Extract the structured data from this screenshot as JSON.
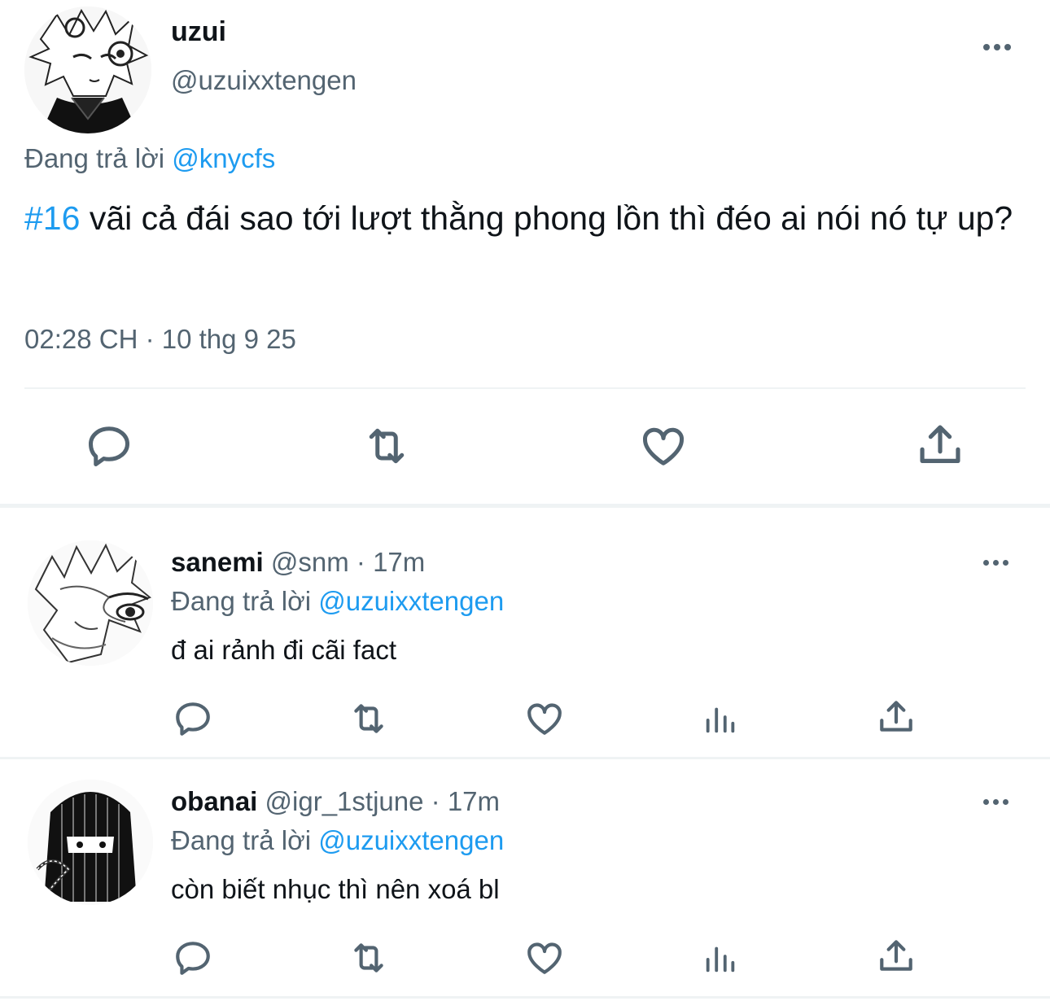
{
  "main_tweet": {
    "display_name": "uzui",
    "handle": "@uzuixxtengen",
    "reply_prefix": "Đang trả lời",
    "reply_to": "@knycfs",
    "hashtag": "#16",
    "text": " vãi cả đái sao tới lượt thằng phong lồn thì đéo ai nói nó tự up?",
    "timestamp": "02:28 CH · 10 thg 9 25",
    "actions": [
      "reply-icon",
      "retweet-icon",
      "like-icon",
      "share-icon"
    ]
  },
  "replies": [
    {
      "display_name": "sanemi",
      "handle": "@snm",
      "time": "· 17m",
      "reply_prefix": "Đang trả lời",
      "reply_to": "@uzuixxtengen",
      "text": "đ ai rảnh đi cãi fact",
      "actions": [
        "reply-icon",
        "retweet-icon",
        "like-icon",
        "views-icon",
        "share-icon"
      ]
    },
    {
      "display_name": "obanai",
      "handle": "@igr_1stjune",
      "time": "· 17m",
      "reply_prefix": "Đang trả lời",
      "reply_to": "@uzuixxtengen",
      "text": "còn biết nhục thì nên xoá bl",
      "actions": [
        "reply-icon",
        "retweet-icon",
        "like-icon",
        "views-icon",
        "share-icon"
      ]
    }
  ],
  "colors": {
    "link": "#1d9bf0",
    "secondary_text": "#536471",
    "primary_text": "#0f1419",
    "divider": "#eff3f4"
  }
}
